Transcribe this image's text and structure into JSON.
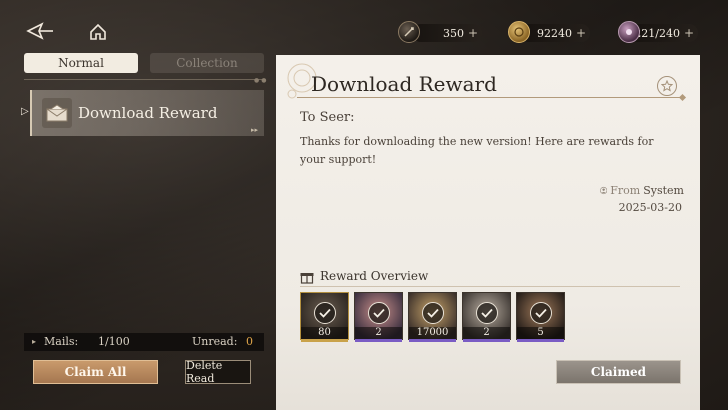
{
  "topbar": {
    "currencies": [
      {
        "icon": "quill-coin-icon",
        "value": "350",
        "plus": "+"
      },
      {
        "icon": "gold-coin-icon",
        "value": "92240",
        "plus": "+"
      },
      {
        "icon": "stamina-icon",
        "value": "221/240",
        "plus": "+"
      }
    ]
  },
  "tabs": [
    {
      "label": "Normal",
      "active": true
    },
    {
      "label": "Collection",
      "active": false
    }
  ],
  "mail_list": [
    {
      "title": "Download Reward",
      "selected": true,
      "icon": "envelope-icon"
    }
  ],
  "mail_footer": {
    "mails_label": "Mails:",
    "mails_count": "1/100",
    "unread_label": "Unread:",
    "unread_count": "0"
  },
  "buttons": {
    "claim_all": "Claim All",
    "delete_read": "Delete Read",
    "claimed": "Claimed"
  },
  "mail": {
    "title": "Download Reward",
    "greeting": "To Seer:",
    "body": "Thanks for downloading the new version! Here are rewards for your support!",
    "from_label": "From",
    "from_value": "System",
    "date": "2025-03-20"
  },
  "rewards": {
    "title": "Reward Overview",
    "items": [
      {
        "qty": "80",
        "rarity_color": "#c9a24a"
      },
      {
        "qty": "2",
        "rarity_color": "#7a5cc4"
      },
      {
        "qty": "17000",
        "rarity_color": "#7a5cc4"
      },
      {
        "qty": "2",
        "rarity_color": "#7a5cc4"
      },
      {
        "qty": "5",
        "rarity_color": "#7a5cc4"
      }
    ]
  },
  "colors": {
    "accent_gold": "#c99a6c",
    "unread_orange": "#e1a64a",
    "panel_bg": "#f4f0ea"
  }
}
